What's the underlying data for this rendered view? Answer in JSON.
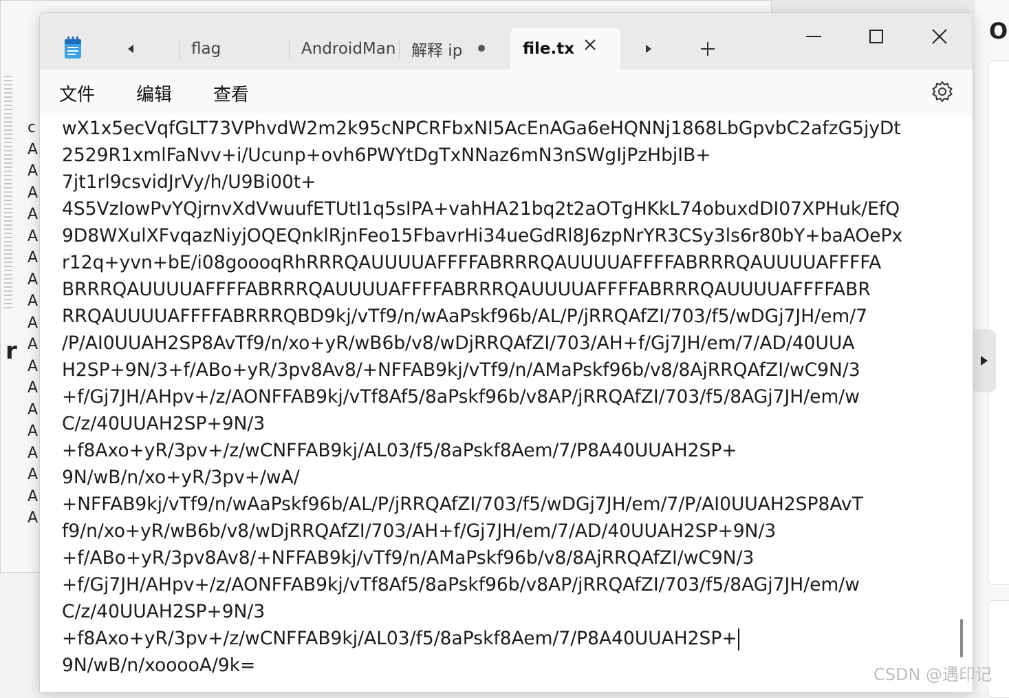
{
  "tabs": {
    "tab1": "flag",
    "tab2": "AndroidMan",
    "tab3": "解释 ip",
    "active": "file.tx"
  },
  "menu": {
    "file": "文件",
    "edit": "编辑",
    "view": "查看"
  },
  "editor": {
    "lines": [
      "wX1x5ecVqfGLT73VPhvdW2m2k95cNPCRFbxNI5AcEnAGa6eHQNNj1868LbGpvbC2afzG5jyDt",
      "2529R1xmlFaNvv+i/Ucunp+ovh6PWYtDgTxNNaz6mN3nSWgIjPzHbjIB+",
      "7jt1rl9csvidJrVy/h/U9Bi00t+",
      "4S5VzIowPvYQjrnvXdVwuufETUtI1q5sIPA+vahHA21bq2t2aOTgHKkL74obuxdDI07XPHuk/EfQ",
      "9D8WXulXFvqazNiyjOQEQnklRjnFeo15FbavrHi34ueGdRl8J6zpNrYR3CSy3ls6r80bY+baAOePx",
      "r12q+yvn+bE/i08goooqRhRRRQAUUUUAFFFFABRRRQAUUUUAFFFFABRRRQAUUUUAFFFFA",
      "BRRRQAUUUUAFFFFABRRRQAUUUUAFFFFABRRRQAUUUUAFFFFABRRRQAUUUUAFFFFABR",
      "RRQAUUUUAFFFFABRRRQBD9kj/vTf9/n/wAaPskf96b/AL/P/jRRQAfZI/703/f5/wDGj7JH/em/7",
      "/P/AI0UUAH2SP8AvTf9/n/xo+yR/wB6b/v8/wDjRRQAfZI/703/AH+f/Gj7JH/em/7/AD/40UUA",
      "H2SP+9N/3+f/ABo+yR/3pv8Av8/+NFFAB9kj/vTf9/n/AMaPskf96b/v8/8AjRRQAfZI/wC9N/3",
      "+f/Gj7JH/AHpv+/z/AONFFAB9kj/vTf8Af5/8aPskf96b/v8AP/jRRQAfZI/703/f5/8AGj7JH/em/w",
      "C/z/40UUAH2SP+9N/3",
      "+f8Axo+yR/3pv+/z/wCNFFAB9kj/AL03/f5/8aPskf8Aem/7/P8A40UUAH2SP+",
      "9N/wB/n/xo+yR/3pv+/wA/",
      "+NFFAB9kj/vTf9/n/wAaPskf96b/AL/P/jRRQAfZI/703/f5/wDGj7JH/em/7/P/AI0UUAH2SP8AvT",
      "f9/n/xo+yR/wB6b/v8/wDjRRQAfZI/703/AH+f/Gj7JH/em/7/AD/40UUAH2SP+9N/3",
      "+f/ABo+yR/3pv8Av8/+NFFAB9kj/vTf9/n/AMaPskf96b/v8/8AjRRQAfZI/wC9N/3",
      "+f/Gj7JH/AHpv+/z/AONFFAB9kj/vTf8Af5/8aPskf96b/v8AP/jRRQAfZI/703/f5/8AGj7JH/em/w",
      "C/z/40UUAH2SP+9N/3",
      "+f8Axo+yR/3pv+/z/wCNFFAB9kj/AL03/f5/8aPskf8Aem/7/P8A40UUAH2SP+",
      "9N/wB/n/xooooA/9k="
    ]
  },
  "watermark": "CSDN @遇印记",
  "colors": {
    "titlebar": "#eaeaea",
    "editor_bg": "#ffffff",
    "text": "#1b1b1b"
  }
}
